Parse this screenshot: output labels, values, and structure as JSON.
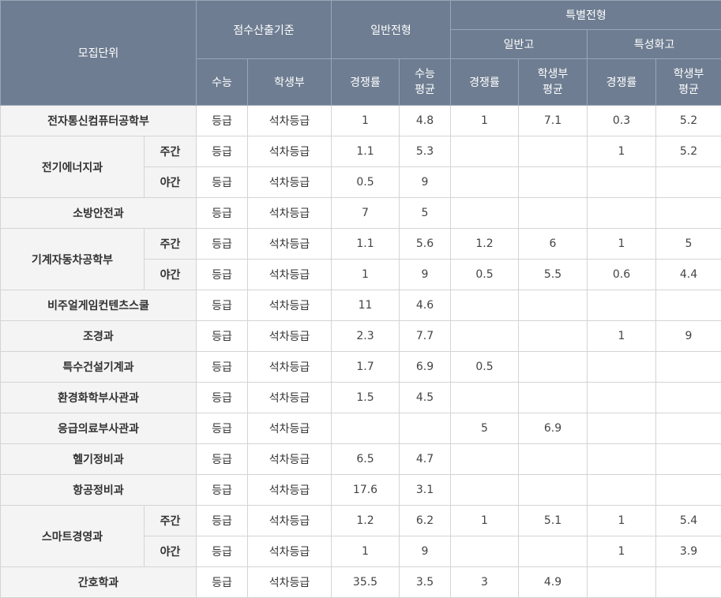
{
  "header": {
    "unit": "모집단위",
    "criteria": "점수산출기준",
    "general": "일반전형",
    "special": "특별전형",
    "special_general": "일반고",
    "special_specialized": "특성화고",
    "suneung": "수능",
    "record": "학생부",
    "rate": "경쟁률",
    "suneung_avg_1": "수능",
    "suneung_avg_2": "평균",
    "record_avg_1": "학생부",
    "record_avg_2": "평균"
  },
  "rows": [
    {
      "dept": "전자통신컴퓨터공학부",
      "shift": "",
      "suneung": "등급",
      "record": "석차등급",
      "g_rate": "1",
      "g_avg": "4.8",
      "sg_rate": "1",
      "sg_avg": "7.1",
      "ss_rate": "0.3",
      "ss_avg": "5.2"
    },
    {
      "dept": "전기에너지과",
      "shift": "주간",
      "suneung": "등급",
      "record": "석차등급",
      "g_rate": "1.1",
      "g_avg": "5.3",
      "sg_rate": "",
      "sg_avg": "",
      "ss_rate": "1",
      "ss_avg": "5.2"
    },
    {
      "dept": "",
      "shift": "야간",
      "suneung": "등급",
      "record": "석차등급",
      "g_rate": "0.5",
      "g_avg": "9",
      "sg_rate": "",
      "sg_avg": "",
      "ss_rate": "",
      "ss_avg": ""
    },
    {
      "dept": "소방안전과",
      "shift": "",
      "suneung": "등급",
      "record": "석차등급",
      "g_rate": "7",
      "g_avg": "5",
      "sg_rate": "",
      "sg_avg": "",
      "ss_rate": "",
      "ss_avg": ""
    },
    {
      "dept": "기계자동차공학부",
      "shift": "주간",
      "suneung": "등급",
      "record": "석차등급",
      "g_rate": "1.1",
      "g_avg": "5.6",
      "sg_rate": "1.2",
      "sg_avg": "6",
      "ss_rate": "1",
      "ss_avg": "5"
    },
    {
      "dept": "",
      "shift": "야간",
      "suneung": "등급",
      "record": "석차등급",
      "g_rate": "1",
      "g_avg": "9",
      "sg_rate": "0.5",
      "sg_avg": "5.5",
      "ss_rate": "0.6",
      "ss_avg": "4.4"
    },
    {
      "dept": "비주얼게임컨텐츠스쿨",
      "shift": "",
      "suneung": "등급",
      "record": "석차등급",
      "g_rate": "11",
      "g_avg": "4.6",
      "sg_rate": "",
      "sg_avg": "",
      "ss_rate": "",
      "ss_avg": ""
    },
    {
      "dept": "조경과",
      "shift": "",
      "suneung": "등급",
      "record": "석차등급",
      "g_rate": "2.3",
      "g_avg": "7.7",
      "sg_rate": "",
      "sg_avg": "",
      "ss_rate": "1",
      "ss_avg": "9"
    },
    {
      "dept": "특수건설기계과",
      "shift": "",
      "suneung": "등급",
      "record": "석차등급",
      "g_rate": "1.7",
      "g_avg": "6.9",
      "sg_rate": "0.5",
      "sg_avg": "",
      "ss_rate": "",
      "ss_avg": ""
    },
    {
      "dept": "환경화학부사관과",
      "shift": "",
      "suneung": "등급",
      "record": "석차등급",
      "g_rate": "1.5",
      "g_avg": "4.5",
      "sg_rate": "",
      "sg_avg": "",
      "ss_rate": "",
      "ss_avg": ""
    },
    {
      "dept": "응급의료부사관과",
      "shift": "",
      "suneung": "등급",
      "record": "석차등급",
      "g_rate": "",
      "g_avg": "",
      "sg_rate": "5",
      "sg_avg": "6.9",
      "ss_rate": "",
      "ss_avg": ""
    },
    {
      "dept": "헬기정비과",
      "shift": "",
      "suneung": "등급",
      "record": "석차등급",
      "g_rate": "6.5",
      "g_avg": "4.7",
      "sg_rate": "",
      "sg_avg": "",
      "ss_rate": "",
      "ss_avg": ""
    },
    {
      "dept": "항공정비과",
      "shift": "",
      "suneung": "등급",
      "record": "석차등급",
      "g_rate": "17.6",
      "g_avg": "3.1",
      "sg_rate": "",
      "sg_avg": "",
      "ss_rate": "",
      "ss_avg": ""
    },
    {
      "dept": "스마트경영과",
      "shift": "주간",
      "suneung": "등급",
      "record": "석차등급",
      "g_rate": "1.2",
      "g_avg": "6.2",
      "sg_rate": "1",
      "sg_avg": "5.1",
      "ss_rate": "1",
      "ss_avg": "5.4"
    },
    {
      "dept": "",
      "shift": "야간",
      "suneung": "등급",
      "record": "석차등급",
      "g_rate": "1",
      "g_avg": "9",
      "sg_rate": "",
      "sg_avg": "",
      "ss_rate": "1",
      "ss_avg": "3.9"
    },
    {
      "dept": "간호학과",
      "shift": "",
      "suneung": "등급",
      "record": "석차등급",
      "g_rate": "35.5",
      "g_avg": "3.5",
      "sg_rate": "3",
      "sg_avg": "4.9",
      "ss_rate": "",
      "ss_avg": ""
    }
  ]
}
